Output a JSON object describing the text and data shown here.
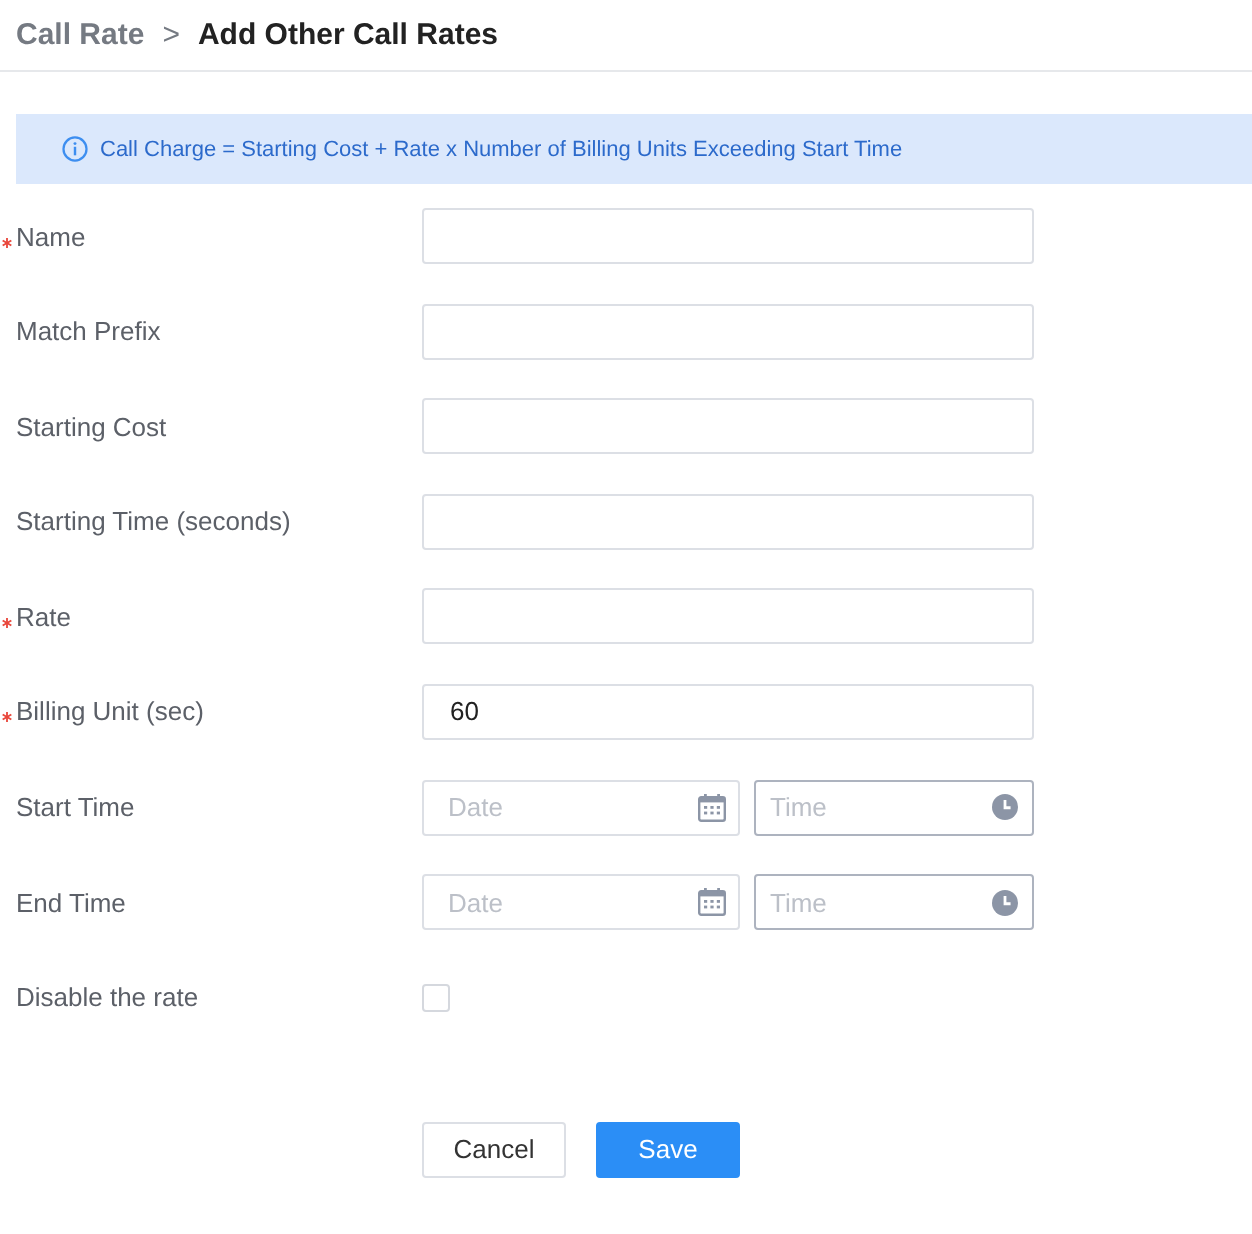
{
  "breadcrumb": {
    "items": [
      {
        "label": "Call Rate",
        "current": false
      },
      {
        "label": "Add Other Call Rates",
        "current": true
      }
    ],
    "separator": ">"
  },
  "info": {
    "text": "Call Charge = Starting Cost + Rate x Number of Billing Units Exceeding Start Time"
  },
  "fields": [
    {
      "kind": "text",
      "label": "Name",
      "required": true
    },
    {
      "kind": "text",
      "label": "Match Prefix",
      "required": false
    },
    {
      "kind": "text",
      "label": "Starting Cost",
      "required": false
    },
    {
      "kind": "text",
      "label": "Starting Time (seconds)",
      "required": false
    },
    {
      "kind": "text",
      "label": "Rate",
      "required": true
    },
    {
      "kind": "text",
      "label": "Billing Unit (sec)",
      "required": true,
      "value": "60"
    },
    {
      "kind": "datetime",
      "label": "Start Time",
      "required": false,
      "date": {
        "placeholder": "Date"
      },
      "time": {
        "placeholder": "Time"
      }
    },
    {
      "kind": "datetime",
      "label": "End Time",
      "required": false,
      "date": {
        "placeholder": "Date"
      },
      "time": {
        "placeholder": "Time"
      }
    },
    {
      "kind": "checkbox",
      "label": "Disable the rate",
      "required": false,
      "checked": false
    }
  ],
  "buttons": [
    {
      "label": "Cancel",
      "kind": "secondary"
    },
    {
      "label": "Save",
      "kind": "primary"
    }
  ]
}
